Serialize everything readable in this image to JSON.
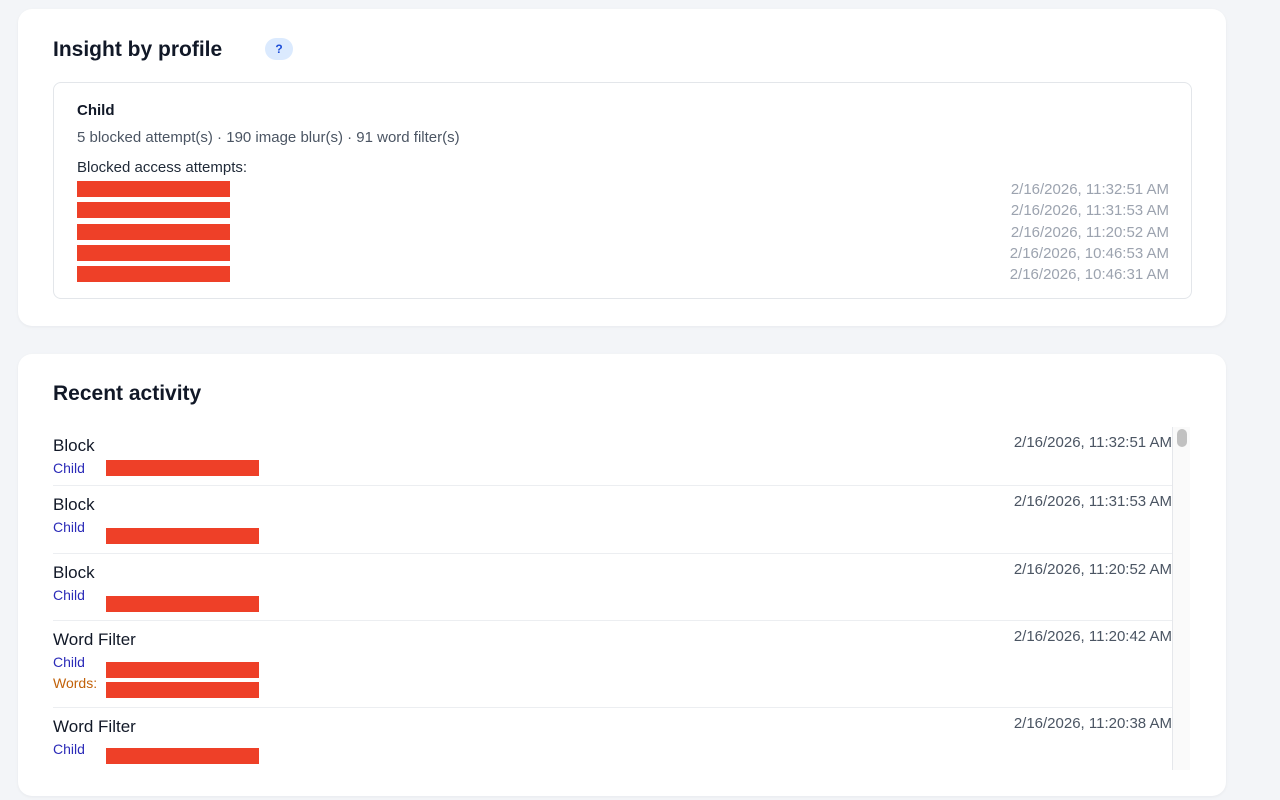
{
  "insight": {
    "title": "Insight by profile",
    "help_label": "?",
    "profile": {
      "name": "Child",
      "stats": "5 blocked attempt(s) · 190 image blur(s) · 91 word filter(s)",
      "attempts_label": "Blocked access attempts:",
      "attempts": [
        {
          "time": "2/16/2026, 11:32:51 AM"
        },
        {
          "time": "2/16/2026, 11:31:53 AM"
        },
        {
          "time": "2/16/2026, 11:20:52 AM"
        },
        {
          "time": "2/16/2026, 10:46:53 AM"
        },
        {
          "time": "2/16/2026, 10:46:31 AM"
        }
      ]
    }
  },
  "activity": {
    "title": "Recent activity",
    "items": [
      {
        "type": "Block",
        "profile": "Child",
        "time": "2/16/2026, 11:32:51 AM"
      },
      {
        "type": "Block",
        "profile": "Child",
        "time": "2/16/2026, 11:31:53 AM"
      },
      {
        "type": "Block",
        "profile": "Child",
        "time": "2/16/2026, 11:20:52 AM"
      },
      {
        "type": "Word Filter",
        "profile": "Child",
        "words_label": "Words:",
        "time": "2/16/2026, 11:20:42 AM"
      },
      {
        "type": "Word Filter",
        "profile": "Child",
        "time": "2/16/2026, 11:20:38 AM"
      }
    ]
  },
  "colors": {
    "redaction": "#ee4028",
    "profile_link": "#2b2bb8",
    "words_label": "#c2620a"
  }
}
